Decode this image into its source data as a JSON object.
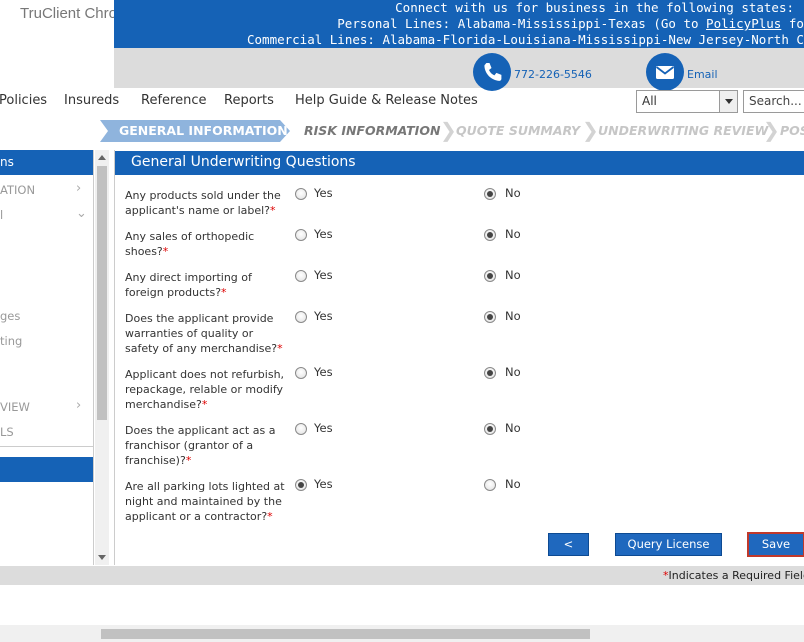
{
  "app": {
    "title": "TruClient Chromium"
  },
  "banner": {
    "line1": "Connect with us for business in the following states:",
    "line2_prefix": "Personal Lines: Alabama-Mississippi-Texas (Go to ",
    "line2_link": "PolicyPlus",
    "line2_suffix": " for ot",
    "line3": "Commercial Lines: Alabama-Florida-Louisiana-Mississippi-New Jersey-North Carol"
  },
  "contact": {
    "phone": "772-226-5546",
    "email": "Email"
  },
  "nav": {
    "items": [
      "Policies",
      "Insureds",
      "Reference",
      "Reports",
      "Help Guide & Release Notes"
    ],
    "filter_value": "All",
    "search_placeholder": "Search..."
  },
  "steps": [
    "GENERAL INFORMATION",
    "RISK INFORMATION",
    "QUOTE SUMMARY",
    "UNDERWRITING REVIEW",
    "POS"
  ],
  "sidebar": {
    "header": "ns",
    "items": [
      "ATION",
      "l",
      "ges",
      "ting",
      "VIEW",
      "LS"
    ]
  },
  "panel": {
    "title": "General Underwriting Questions",
    "yes_label": "Yes",
    "no_label": "No",
    "questions": [
      {
        "text": "Any products sold under the applicant's name or label?",
        "answer": "No"
      },
      {
        "text": "Any sales of orthopedic shoes?",
        "answer": "No"
      },
      {
        "text": "Any direct importing of foreign products?",
        "answer": "No"
      },
      {
        "text": "Does the applicant provide warranties of quality or safety of any merchandise?",
        "answer": "No"
      },
      {
        "text": "Applicant does not refurbish, repackage, relable or modify merchandise?",
        "answer": "No"
      },
      {
        "text": "Does the applicant act as a franchisor (grantor of a franchise)?",
        "answer": "No"
      },
      {
        "text": "Are all parking lots lighted at night and maintained by the applicant or a contractor?",
        "answer": "Yes"
      }
    ]
  },
  "buttons": {
    "back": "<",
    "query_license": "Query License",
    "save": "Save"
  },
  "footer": {
    "required_star": "*",
    "required_text": "Indicates a Required Field"
  },
  "colors": {
    "brand_blue": "#1562b6",
    "required_red": "#dd0000",
    "save_border": "#c0392b"
  }
}
